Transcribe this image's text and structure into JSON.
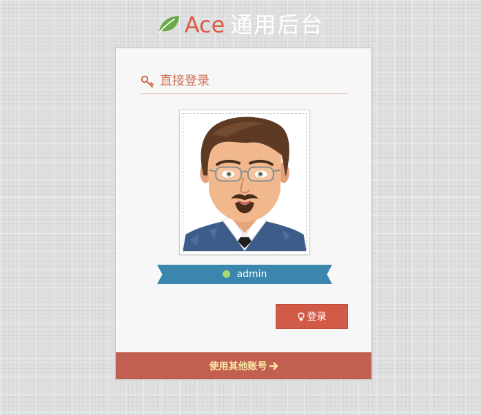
{
  "brand": {
    "icon": "leaf-icon",
    "name": "Ace",
    "subtitle": "通用后台",
    "accent_color": "#dd5a43",
    "leaf_color": "#69aa46"
  },
  "login_box": {
    "title": "直接登录",
    "title_icon": "key-icon",
    "avatar": "avatar-image",
    "user": {
      "name": "admin",
      "status_color": "#a9d96c",
      "ribbon_color": "#3a86ad"
    },
    "login_button": {
      "label": "登录",
      "icon": "lightbulb-icon",
      "color": "#d15b47"
    },
    "footer": {
      "link_label": "使用其他账号",
      "link_icon": "arrow-right-icon",
      "background": "#c16050"
    }
  }
}
